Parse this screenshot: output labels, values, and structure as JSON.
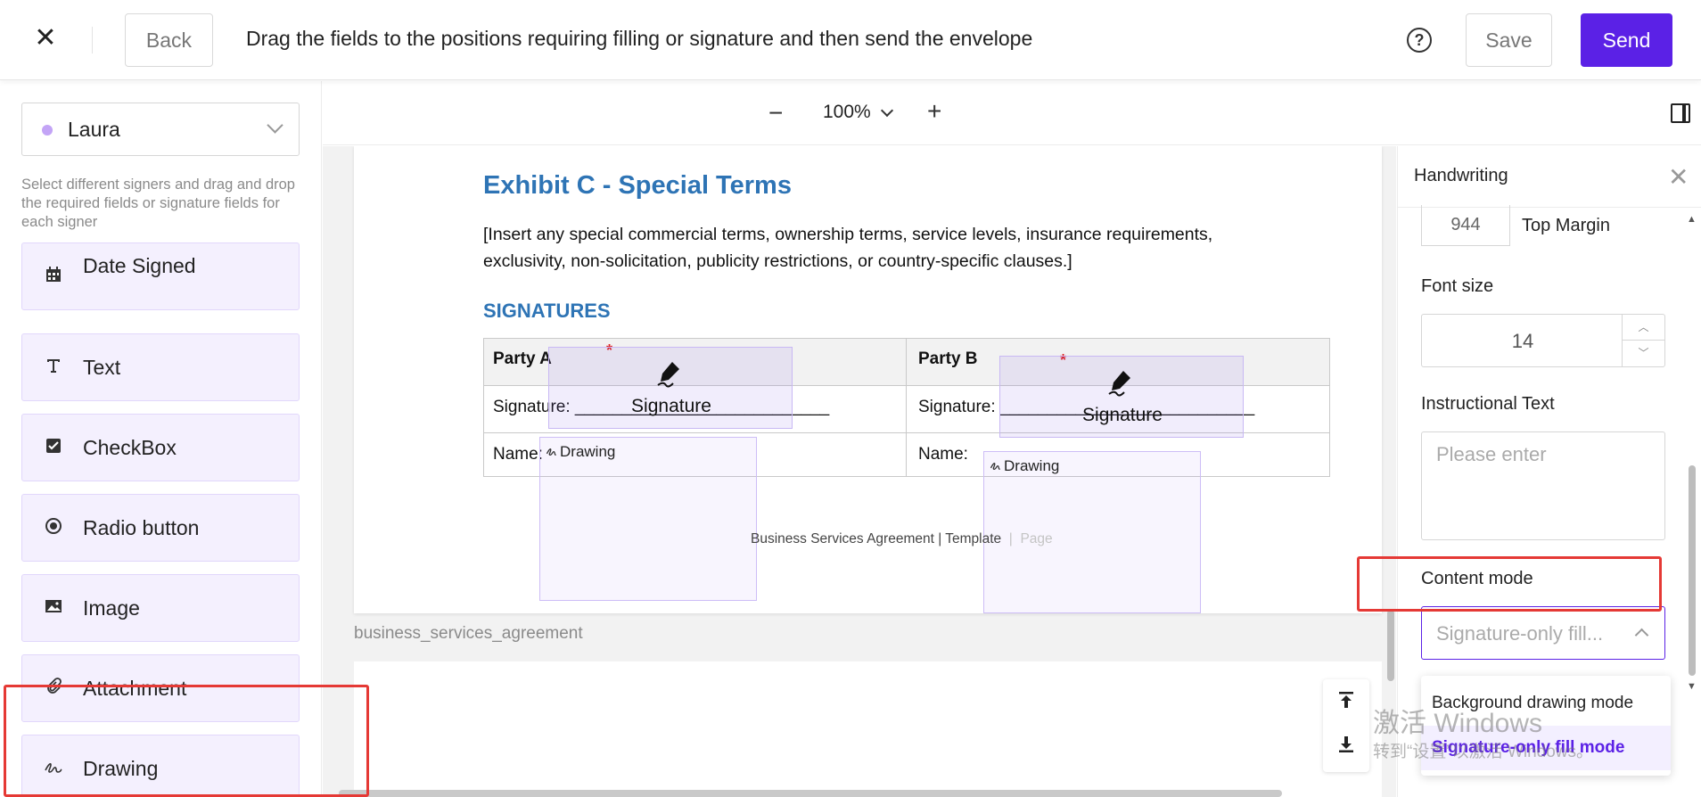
{
  "header": {
    "close_icon": "close-icon",
    "back_label": "Back",
    "title": "Drag the fields to the positions requiring filling or signature and then send the envelope",
    "help_icon": "help-icon",
    "save_label": "Save",
    "send_label": "Send",
    "send_color": "#5b21e6"
  },
  "sidebar": {
    "signer": {
      "name": "Laura",
      "dot_color": "#c3a4f6"
    },
    "hint": "Select different signers and drag and drop the required fields or signature fields for each signer",
    "fields": [
      {
        "label": "Date Signed",
        "icon": "calendar-icon"
      },
      {
        "label": "Text",
        "icon": "text-icon"
      },
      {
        "label": "CheckBox",
        "icon": "checkbox-icon"
      },
      {
        "label": "Radio button",
        "icon": "radio-icon"
      },
      {
        "label": "Image",
        "icon": "image-icon"
      },
      {
        "label": "Attachment",
        "icon": "paperclip-icon"
      },
      {
        "label": "Drawing",
        "icon": "drawing-icon"
      }
    ]
  },
  "toolbar": {
    "zoom_minus": "−",
    "zoom": "100%",
    "zoom_plus": "+"
  },
  "document": {
    "heading": "Exhibit C - Special Terms",
    "paragraph": "[Insert any special commercial terms, ownership terms, service levels, insurance requirements, exclusivity, non-solicitation, publicity restrictions, or country-specific clauses.]",
    "signatures_heading": "SIGNATURES",
    "party_a": "Party A",
    "party_b": "Party B",
    "signature_label_a": "Signature: ___________________________",
    "signature_label_b": "Signature: ___________________________",
    "name_label_a": "Name:",
    "name_label_b": "Name:",
    "required_mark": "*",
    "signature_field_label": "Signature",
    "drawing_field_label": "Drawing",
    "footer": "Business Services Agreement | Template",
    "footer_sep": "|",
    "footer_page": "Page",
    "doc_name": "business_services_agreement"
  },
  "right_panel": {
    "title": "Handwriting",
    "top_margin_value": "944",
    "top_margin_label": "Top Margin",
    "font_size_label": "Font size",
    "font_size_value": "14",
    "instructional_label": "Instructional Text",
    "instructional_placeholder": "Please enter",
    "content_mode_label": "Content mode",
    "content_mode_value": "Signature-only fill...",
    "content_mode_options": [
      "Background drawing mode",
      "Signature-only fill mode"
    ],
    "selected_option": "Signature-only fill mode"
  },
  "watermark": {
    "line1": "激活 Windows",
    "line2": "转到“设置”以激活 Windows。"
  }
}
